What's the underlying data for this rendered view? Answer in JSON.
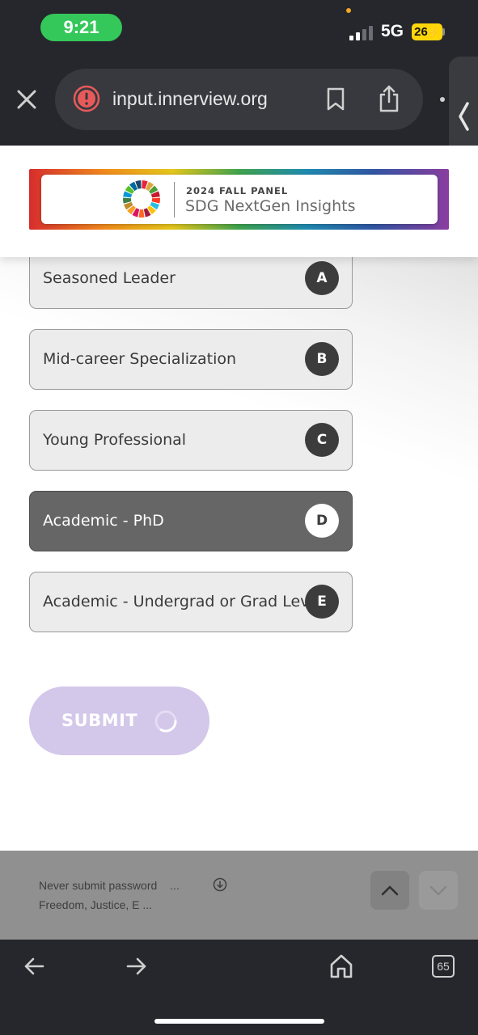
{
  "status_bar": {
    "time": "9:21",
    "network": "5G",
    "battery": "26"
  },
  "browser": {
    "url": "input.innerview.org",
    "tab_count": "65"
  },
  "banner": {
    "kicker": "2024 FALL PANEL",
    "title": "SDG NextGen Insights"
  },
  "options": [
    {
      "label": "Seasoned Leader",
      "key": "A",
      "selected": false
    },
    {
      "label": "Mid-career Specialization",
      "key": "B",
      "selected": false
    },
    {
      "label": "Young Professional",
      "key": "C",
      "selected": false
    },
    {
      "label": "Academic - PhD",
      "key": "D",
      "selected": true
    },
    {
      "label": "Academic - Undergrad or Grad Level",
      "key": "E",
      "selected": false
    }
  ],
  "submit": {
    "label": "SUBMIT",
    "loading": true
  },
  "autofill": {
    "line1": "Never submit password",
    "line1_more": "...",
    "line2": "Freedom, Justice, E ..."
  },
  "colors": {
    "selected_bg": "#666666",
    "submit_bg": "#d3c7ea",
    "time_pill": "#34c759",
    "battery": "#ffd60a",
    "warning": "#e85a5a"
  },
  "icons": [
    "close-icon",
    "warning-icon",
    "bookmark-icon",
    "share-icon",
    "sdg-wheel-icon",
    "spinner-icon",
    "download-icon",
    "chevron-up-icon",
    "chevron-down-icon",
    "back-arrow-icon",
    "forward-arrow-icon",
    "home-icon",
    "tabs-icon"
  ]
}
